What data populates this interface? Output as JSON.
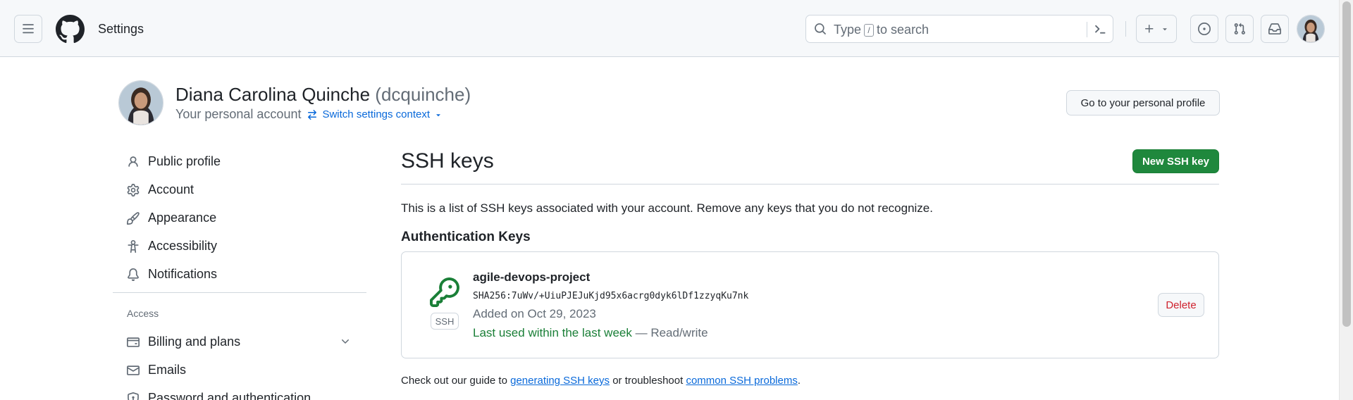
{
  "header": {
    "title": "Settings",
    "search": {
      "prefix": "Type",
      "key": "/",
      "suffix": "to search"
    },
    "icons": [
      "hamburger-icon",
      "github-logo",
      "search-icon",
      "command-palette-icon",
      "plus-icon",
      "chevron-down-icon",
      "issues-icon",
      "pull-requests-icon",
      "inbox-icon",
      "user-avatar"
    ]
  },
  "profile": {
    "name": "Diana Carolina Quinche",
    "handle": "(dcquinche)",
    "subtitle": "Your personal account",
    "switch_label": "Switch settings context",
    "go_profile_label": "Go to your personal profile"
  },
  "sidebar": {
    "items": [
      {
        "label": "Public profile",
        "icon": "person-icon"
      },
      {
        "label": "Account",
        "icon": "gear-icon"
      },
      {
        "label": "Appearance",
        "icon": "paintbrush-icon"
      },
      {
        "label": "Accessibility",
        "icon": "accessibility-icon"
      },
      {
        "label": "Notifications",
        "icon": "bell-icon"
      }
    ],
    "access_heading": "Access",
    "access_items": [
      {
        "label": "Billing and plans",
        "icon": "credit-card-icon"
      },
      {
        "label": "Emails",
        "icon": "mail-icon"
      },
      {
        "label": "Password and authentication",
        "icon": "shield-lock-icon"
      }
    ]
  },
  "main": {
    "title": "SSH keys",
    "new_key_label": "New SSH key",
    "description": "This is a list of SSH keys associated with your account. Remove any keys that you do not recognize.",
    "section_title": "Authentication Keys",
    "keys": [
      {
        "name": "agile-devops-project",
        "fingerprint": "SHA256:7uWv/+UiuPJEJuKjd95x6acrg0dyk6lDf1zzyqKu7nk",
        "added": "Added on Oct 29, 2023",
        "last_used": "Last used within the last week",
        "access": "— Read/write",
        "badge": "SSH",
        "delete_label": "Delete"
      }
    ],
    "footer": {
      "prefix": "Check out our guide to",
      "link1": "generating SSH keys",
      "middle": "or troubleshoot",
      "link2": "common SSH problems",
      "suffix": "."
    }
  },
  "colors": {
    "primary_green": "#1f883d",
    "link_blue": "#0969da",
    "danger_red": "#cf222e",
    "border": "#d0d7de",
    "muted_text": "#636c76"
  }
}
